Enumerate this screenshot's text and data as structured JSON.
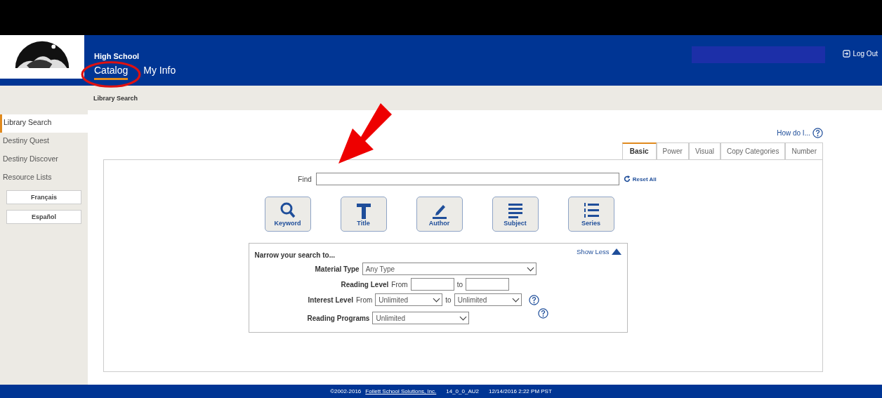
{
  "header": {
    "school": "High School",
    "nav": [
      {
        "label": "Catalog",
        "selected": true
      },
      {
        "label": "My Info",
        "selected": false
      }
    ],
    "logout": "Log Out"
  },
  "breadcrumb": "Library Search",
  "sidebar": {
    "items": [
      {
        "label": "Library Search",
        "selected": true
      },
      {
        "label": "Destiny Quest",
        "selected": false
      },
      {
        "label": "Destiny Discover",
        "selected": false
      },
      {
        "label": "Resource Lists",
        "selected": false
      }
    ],
    "buttons": [
      "Français",
      "Español"
    ]
  },
  "help_link": "How do I...",
  "tabs": [
    {
      "label": "Basic",
      "selected": true
    },
    {
      "label": "Power",
      "selected": false
    },
    {
      "label": "Visual",
      "selected": false
    },
    {
      "label": "Copy Categories",
      "selected": false
    },
    {
      "label": "Number",
      "selected": false
    }
  ],
  "find": {
    "label": "Find",
    "reset": "Reset All"
  },
  "search_buttons": [
    {
      "kind": "keyword",
      "label": "Keyword"
    },
    {
      "kind": "title",
      "label": "Title"
    },
    {
      "kind": "author",
      "label": "Author"
    },
    {
      "kind": "subject",
      "label": "Subject"
    },
    {
      "kind": "series",
      "label": "Series"
    }
  ],
  "narrow": {
    "title": "Narrow your search to...",
    "toggle": "Show Less",
    "material_type": {
      "label": "Material Type",
      "value": "Any Type"
    },
    "reading_level": {
      "label": "Reading Level",
      "from": "From",
      "to": "to"
    },
    "interest_level": {
      "label": "Interest Level",
      "from": "From",
      "from_value": "Unlimited",
      "to": "to",
      "to_value": "Unlimited"
    },
    "reading_programs": {
      "label": "Reading Programs",
      "value": "Unlimited"
    }
  },
  "footer": {
    "copyright": "©2002-2016",
    "company": "Follett School Solutions, Inc.",
    "version": "14_0_0_AU2",
    "timestamp": "12/14/2016 2:22 PM PST"
  }
}
